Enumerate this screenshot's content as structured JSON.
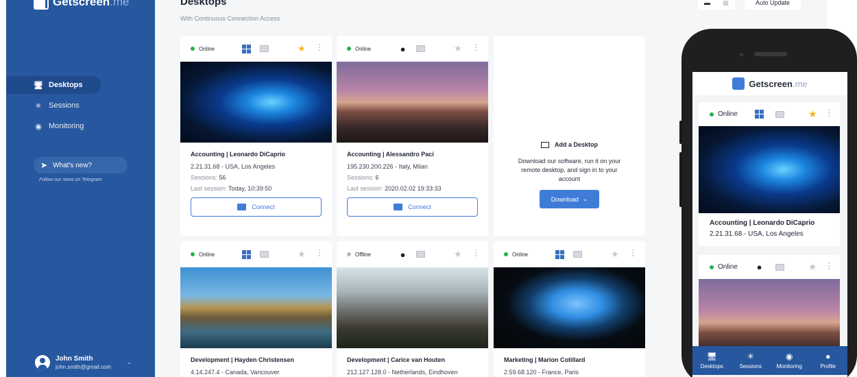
{
  "app": {
    "brand": "Getscreen",
    "brand_suffix": ".me"
  },
  "sidebar": {
    "items": [
      {
        "label": "Desktops",
        "icon": "desktop-icon"
      },
      {
        "label": "Sessions",
        "icon": "sessions-icon"
      },
      {
        "label": "Monitoring",
        "icon": "eye-icon"
      }
    ],
    "whats_new": "What's new?",
    "follow": "Follow our news on Telegram",
    "user": {
      "name": "John Smith",
      "email": "john.smith@gmail.com"
    }
  },
  "main": {
    "title": "Desktops",
    "subtitle": "With Continuous Connection Access",
    "auto_update": "Auto Update",
    "connect_label": "Connect",
    "cards": [
      {
        "status": "Online",
        "os": "windows",
        "fav": true,
        "name": "Accounting | Leonardo DiCaprio",
        "ip": "2.21.31.68 - USA, Los Angeles",
        "sessions_label": "Sessions:",
        "sessions": "56",
        "last_label": "Last session:",
        "last": "Today, 10:39:50"
      },
      {
        "status": "Online",
        "os": "mac",
        "fav": false,
        "name": "Accounting | Alessandro Paci",
        "ip": "195.230.200.226 - Italy, Milan",
        "sessions_label": "Sessions:",
        "sessions": "6",
        "last_label": "Last session:",
        "last": "2020.02.02 19:33:33"
      },
      {
        "status": "Online",
        "os": "windows",
        "fav": false,
        "name": "Development | Hayden Christensen",
        "ip": "4.14.247.4 - Canada, Vancouver"
      },
      {
        "status": "Offline",
        "os": "mac",
        "fav": false,
        "name": "Development | Carice van Houten",
        "ip": "212.127.128.0 - Netherlands, Eindhoven"
      },
      {
        "status": "Online",
        "os": "windows",
        "fav": false,
        "name": "Marketing | Marion Cotillard",
        "ip": "2.59.68.120 - France, Paris"
      }
    ],
    "add_card": {
      "title": "Add a Desktop",
      "description": "Download our software, run it on your remote desktop, and sign in to your account",
      "button": "Download"
    }
  },
  "phone": {
    "brand": "Getscreen",
    "brand_suffix": ".me",
    "cards": [
      {
        "status": "Online",
        "name": "Accounting | Leonardo DiCaprio",
        "ip": "2.21.31.68 - USA, Los Angeles"
      },
      {
        "status": "Online"
      }
    ],
    "tabs": [
      {
        "label": "Desktops"
      },
      {
        "label": "Sessions"
      },
      {
        "label": "Monitoring"
      },
      {
        "label": "Profile"
      }
    ]
  }
}
